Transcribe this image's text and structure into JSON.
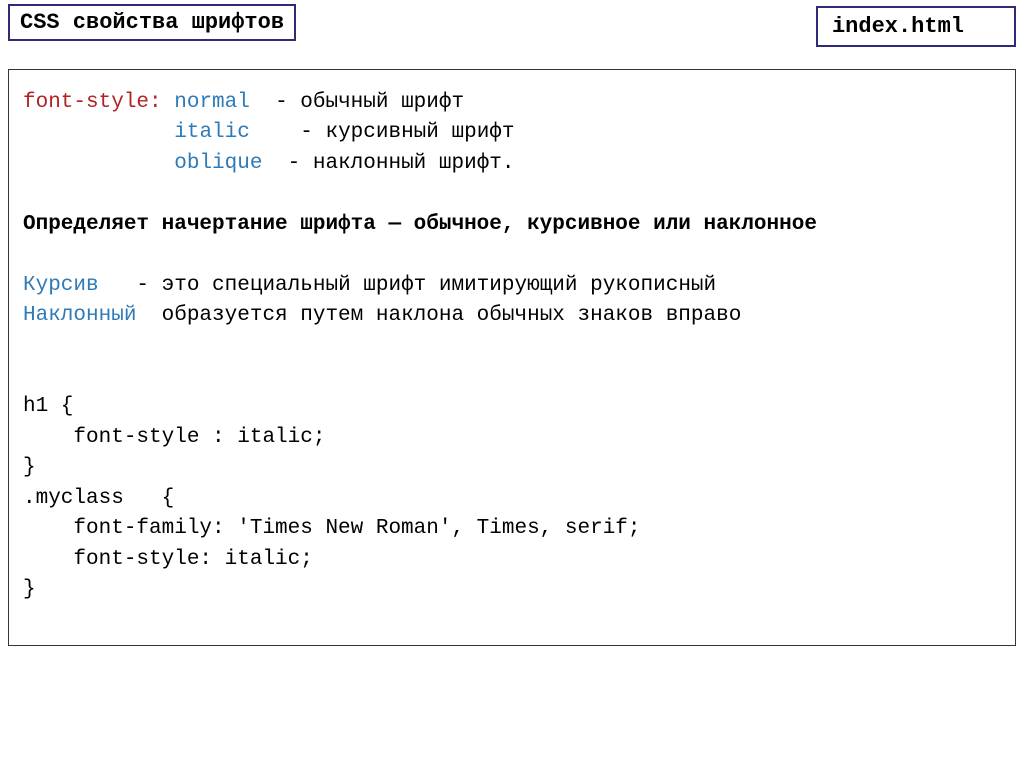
{
  "header": {
    "title": "CSS свойства шрифтов",
    "filename": "index.html"
  },
  "content": {
    "property": "font-style:",
    "val1": "normal",
    "desc1": "  - обычный шрифт",
    "val2": "italic",
    "desc2": "    - курсивный шрифт",
    "val3": "oblique",
    "desc3": "  - наклонный шрифт.",
    "summary": "Определяет начертание шрифта — обычное, курсивное или наклонное",
    "term1": "Курсив",
    "term1_desc": "   - это специальный шрифт имитирующий рукописный",
    "term2": "Наклонный",
    "term2_desc": "  образуется путем наклона обычных знаков вправо",
    "code1": "h1 {",
    "code2": "    font-style : italic;",
    "code3": "}",
    "code4": ".myclass   {",
    "code5": "    font-family: 'Times New Roman', Times, serif;",
    "code6": "    font-style: italic;",
    "code7": "}"
  }
}
